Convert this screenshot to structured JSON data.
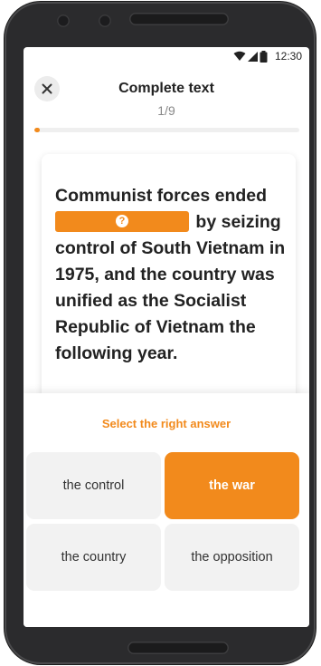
{
  "status_bar": {
    "time": "12:30",
    "icons": [
      "wifi-icon",
      "cellular-icon",
      "battery-icon"
    ]
  },
  "header": {
    "title": "Complete text",
    "progress": "1/9",
    "progress_fraction": 0.02
  },
  "question": {
    "before_blank": "Communist forces ended",
    "after_blank": "by seizing control of South Vietnam in 1975, and the country was unified as the Socialist Republic of Vietnam the following year.",
    "blank_icon": "?"
  },
  "answers": {
    "prompt": "Select the right answer",
    "options": [
      {
        "label": "the control",
        "selected": false
      },
      {
        "label": "the war",
        "selected": true
      },
      {
        "label": "the country",
        "selected": false
      },
      {
        "label": "the opposition",
        "selected": false
      }
    ]
  },
  "colors": {
    "accent": "#f28a1c",
    "option_bg": "#f2f2f2",
    "text": "#222222"
  }
}
